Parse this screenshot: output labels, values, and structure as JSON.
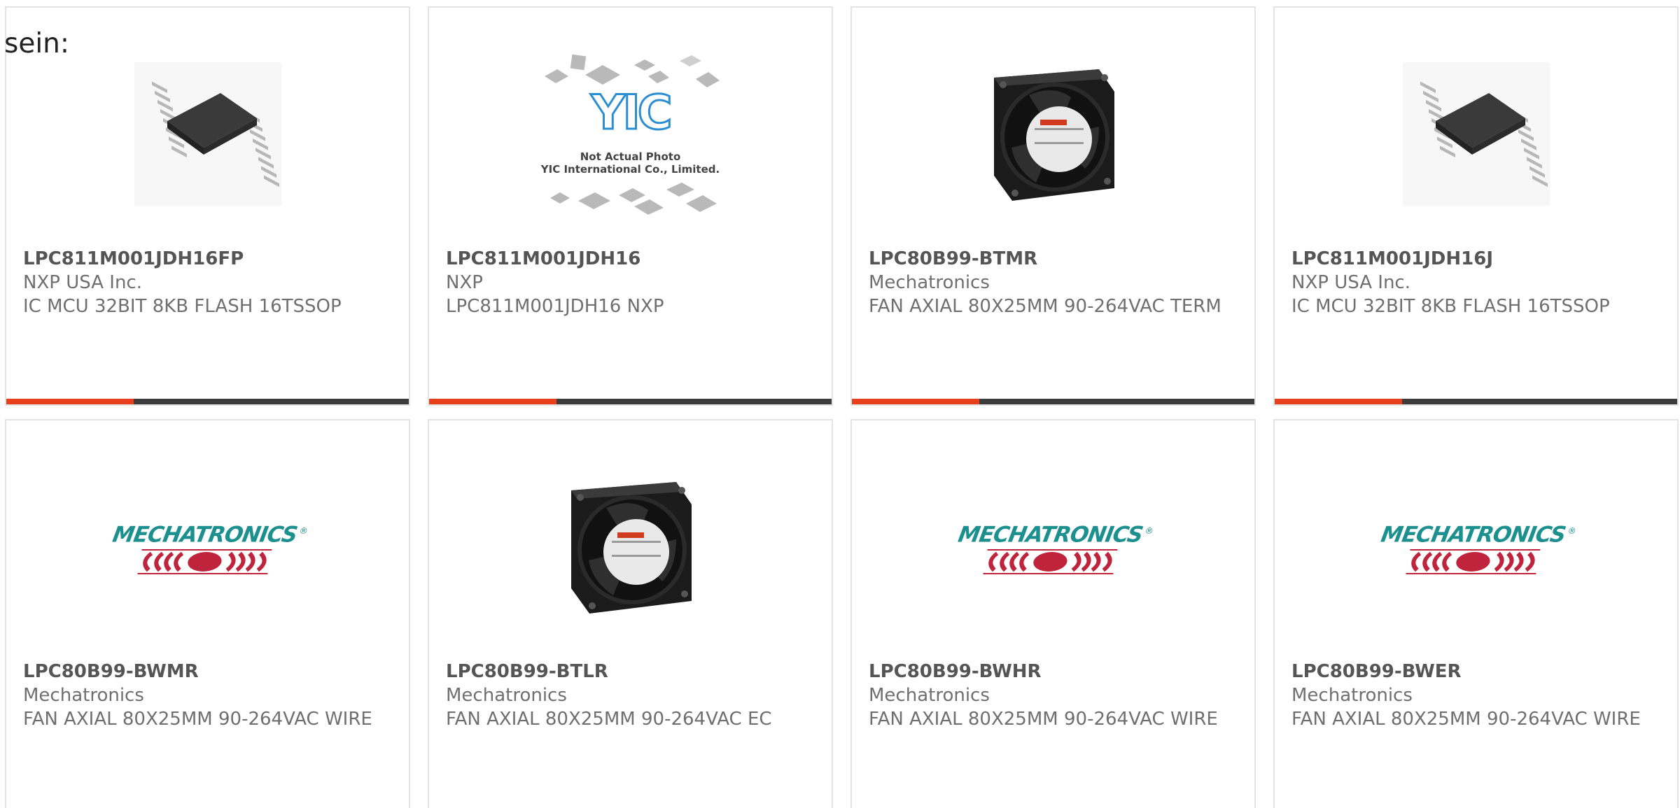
{
  "heading": "sein:",
  "brand": {
    "accent_color": "#e8401c",
    "bar_color": "#3c3c3c",
    "logo_text": "MECHATRONICS",
    "logo_mark": "®",
    "logo_teal": "#1c8f8f",
    "logo_red": "#c0243d",
    "placeholder_line1": "Not Actual Photo",
    "placeholder_line2": "YIC International Co., Limited.",
    "placeholder_logo": "YIC"
  },
  "products": [
    {
      "part": "LPC811M001JDH16FP",
      "manufacturer": "NXP USA Inc.",
      "description": "IC MCU 32BIT 8KB FLASH 16TSSOP",
      "image": "tssop-chip-icon"
    },
    {
      "part": "LPC811M001JDH16",
      "manufacturer": "NXP",
      "description": "LPC811M001JDH16 NXP",
      "image": "not-actual-photo-icon"
    },
    {
      "part": "LPC80B99-BTMR",
      "manufacturer": "Mechatronics",
      "description": "FAN AXIAL 80X25MM 90-264VAC TERM",
      "image": "axial-fan-icon"
    },
    {
      "part": "LPC811M001JDH16J",
      "manufacturer": "NXP USA Inc.",
      "description": "IC MCU 32BIT 8KB FLASH 16TSSOP",
      "image": "tssop-chip-icon"
    },
    {
      "part": "LPC80B99-BWMR",
      "manufacturer": "Mechatronics",
      "description": "FAN AXIAL 80X25MM 90-264VAC WIRE",
      "image": "mechatronics-logo-icon"
    },
    {
      "part": "LPC80B99-BTLR",
      "manufacturer": "Mechatronics",
      "description": "FAN AXIAL 80X25MM 90-264VAC EC",
      "image": "axial-fan-icon"
    },
    {
      "part": "LPC80B99-BWHR",
      "manufacturer": "Mechatronics",
      "description": "FAN AXIAL 80X25MM 90-264VAC WIRE",
      "image": "mechatronics-logo-icon"
    },
    {
      "part": "LPC80B99-BWER",
      "manufacturer": "Mechatronics",
      "description": "FAN AXIAL 80X25MM 90-264VAC WIRE",
      "image": "mechatronics-logo-icon"
    }
  ]
}
